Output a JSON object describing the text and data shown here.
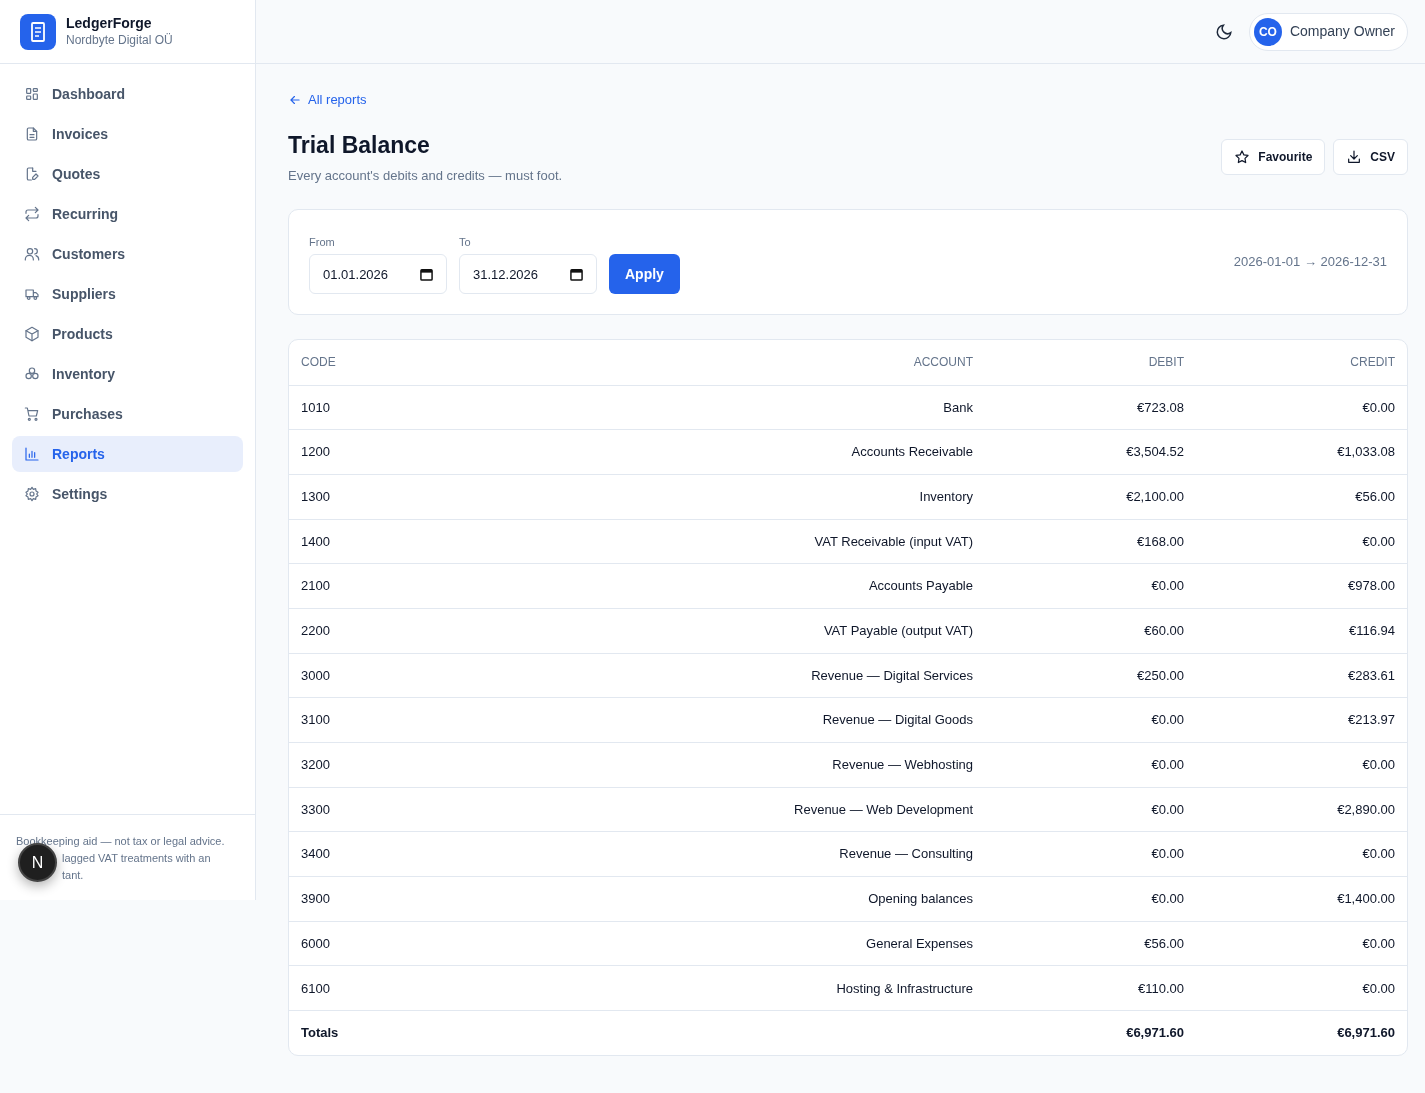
{
  "brand": {
    "name": "LedgerForge",
    "company": "Nordbyte Digital OÜ"
  },
  "nav": [
    {
      "label": "Dashboard",
      "selected": false
    },
    {
      "label": "Invoices",
      "selected": false
    },
    {
      "label": "Quotes",
      "selected": false
    },
    {
      "label": "Recurring",
      "selected": false
    },
    {
      "label": "Customers",
      "selected": false
    },
    {
      "label": "Suppliers",
      "selected": false
    },
    {
      "label": "Products",
      "selected": false
    },
    {
      "label": "Inventory",
      "selected": false
    },
    {
      "label": "Purchases",
      "selected": false
    },
    {
      "label": "Reports",
      "selected": true
    },
    {
      "label": "Settings",
      "selected": false
    }
  ],
  "sidebar_footer": [
    "Bookkeeping aid — not tax or legal advice.",
    "lagged VAT treatments with an",
    "tant."
  ],
  "dev_badge": "N",
  "user": {
    "initials": "CO",
    "name": "Company Owner"
  },
  "back_link": "All reports",
  "title": "Trial Balance",
  "subtitle": "Every account's debits and credits — must foot.",
  "actions": [
    "Favourite",
    "CSV"
  ],
  "filters": {
    "from_label": "From",
    "from": "01.01.2026",
    "to_label": "To",
    "to": "31.12.2026",
    "apply": "Apply",
    "range": "2026-01-01 → 2026-12-31"
  },
  "table": {
    "columns": [
      "CODE",
      "ACCOUNT",
      "DEBIT",
      "CREDIT"
    ],
    "rows": [
      [
        "1010",
        "Bank",
        "€723.08",
        "€0.00"
      ],
      [
        "1200",
        "Accounts Receivable",
        "€3,504.52",
        "€1,033.08"
      ],
      [
        "1300",
        "Inventory",
        "€2,100.00",
        "€56.00"
      ],
      [
        "1400",
        "VAT Receivable (input VAT)",
        "€168.00",
        "€0.00"
      ],
      [
        "2100",
        "Accounts Payable",
        "€0.00",
        "€978.00"
      ],
      [
        "2200",
        "VAT Payable (output VAT)",
        "€60.00",
        "€116.94"
      ],
      [
        "3000",
        "Revenue — Digital Services",
        "€250.00",
        "€283.61"
      ],
      [
        "3100",
        "Revenue — Digital Goods",
        "€0.00",
        "€213.97"
      ],
      [
        "3200",
        "Revenue — Webhosting",
        "€0.00",
        "€0.00"
      ],
      [
        "3300",
        "Revenue — Web Development",
        "€0.00",
        "€2,890.00"
      ],
      [
        "3400",
        "Revenue — Consulting",
        "€0.00",
        "€0.00"
      ],
      [
        "3900",
        "Opening balances",
        "€0.00",
        "€1,400.00"
      ],
      [
        "6000",
        "General Expenses",
        "€56.00",
        "€0.00"
      ],
      [
        "6100",
        "Hosting & Infrastructure",
        "€110.00",
        "€0.00"
      ]
    ],
    "totals": [
      "Totals",
      "€6,971.60",
      "€6,971.60"
    ]
  }
}
